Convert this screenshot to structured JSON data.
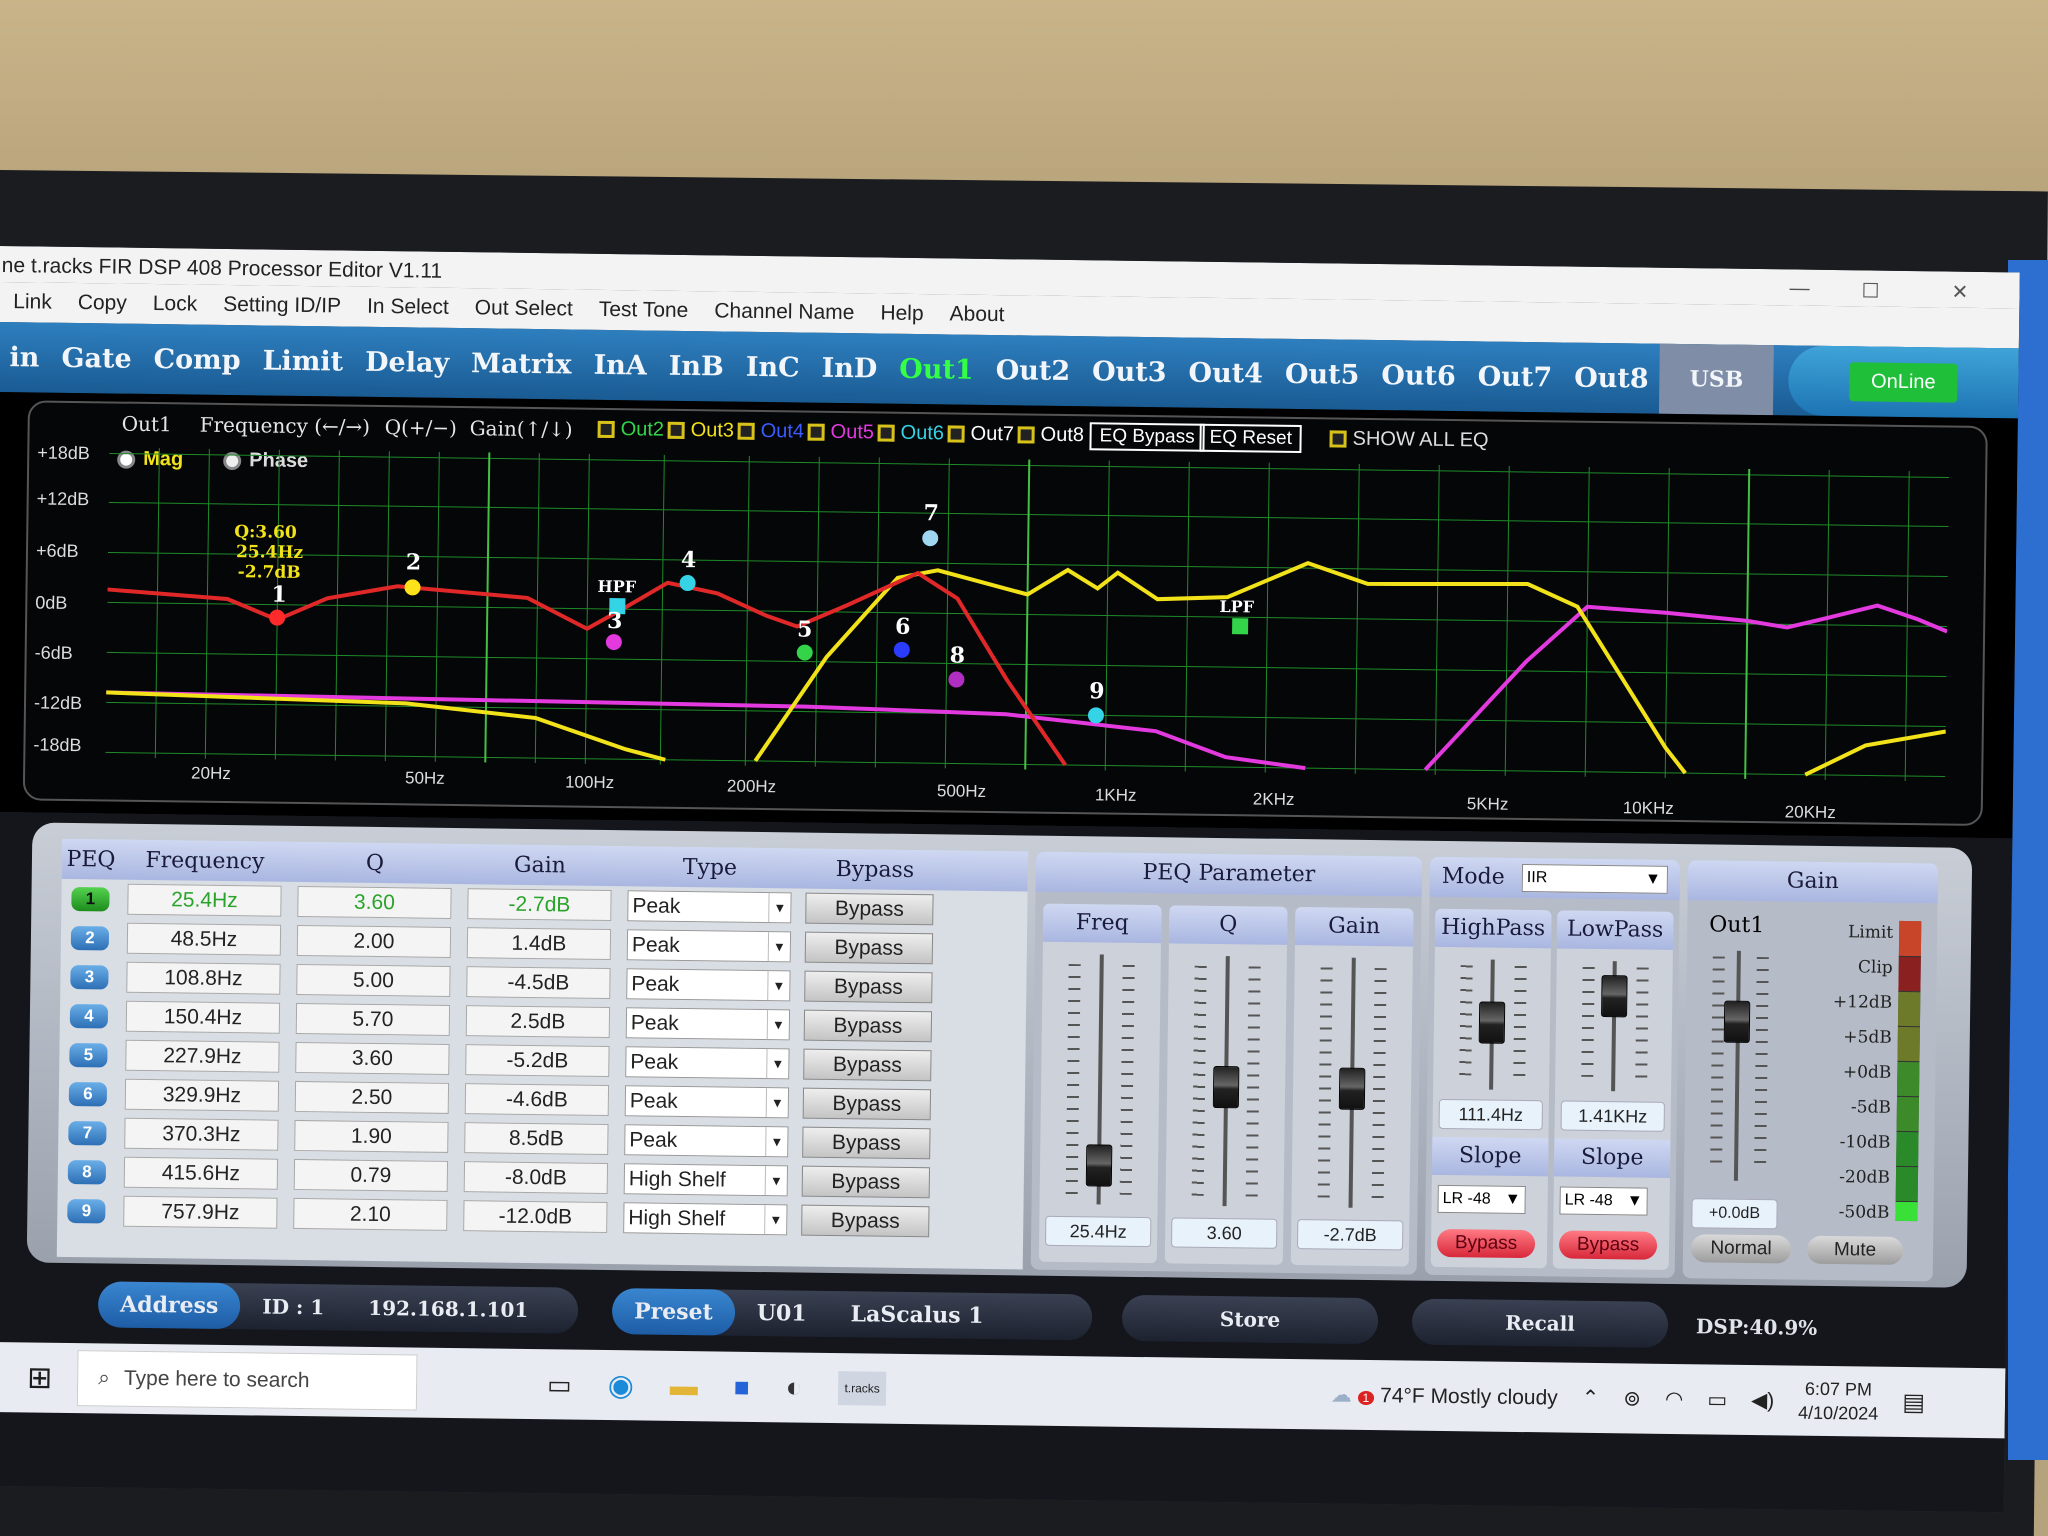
{
  "window": {
    "title": "ne t.racks FIR DSP 408 Processor Editor V1.11",
    "controls": [
      "—",
      "☐",
      "✕"
    ]
  },
  "menu": [
    "Link",
    "Copy",
    "Lock",
    "Setting ID/IP",
    "In Select",
    "Out Select",
    "Test Tone",
    "Channel Name",
    "Help",
    "About"
  ],
  "tabs": [
    "in",
    "Gate",
    "Comp",
    "Limit",
    "Delay",
    "Matrix",
    "InA",
    "InB",
    "InC",
    "InD",
    "Out1",
    "Out2",
    "Out3",
    "Out4",
    "Out5",
    "Out6",
    "Out7",
    "Out8"
  ],
  "active_tab": "Out1",
  "usb_label": "USB",
  "online_label": "OnLine",
  "graph": {
    "channel": "Out1",
    "freq_hint": "Frequency (←/→)",
    "q_hint": "Q(+/−)",
    "gain_hint": "Gain(↑/↓)",
    "overlays": [
      {
        "label": "Out2",
        "color": "#33d44a"
      },
      {
        "label": "Out3",
        "color": "#f2e21a"
      },
      {
        "label": "Out4",
        "color": "#3a5cff"
      },
      {
        "label": "Out5",
        "color": "#e23adf"
      },
      {
        "label": "Out6",
        "color": "#35d3e6"
      },
      {
        "label": "Out7",
        "color": "#ffffff"
      },
      {
        "label": "Out8",
        "color": "#ffffff"
      }
    ],
    "eq_bypass_label": "EQ Bypass",
    "eq_reset_label": "EQ Reset",
    "show_all_label": "SHOW ALL EQ",
    "mag_label": "Mag",
    "phase_label": "Phase",
    "y_ticks": [
      "+18dB",
      "+12dB",
      "+6dB",
      "0dB",
      "-6dB",
      "-12dB",
      "-18dB"
    ],
    "x_ticks": [
      "20Hz",
      "50Hz",
      "100Hz",
      "200Hz",
      "500Hz",
      "1KHz",
      "2KHz",
      "5KHz",
      "10KHz",
      "20KHz"
    ],
    "tooltip": [
      "Q:3.60",
      "25.4Hz",
      "-2.7dB"
    ],
    "hpf_label": "HPF",
    "lpf_label": "LPF",
    "point_labels": [
      "1",
      "2",
      "3",
      "4",
      "5",
      "6",
      "7",
      "8",
      "9"
    ]
  },
  "peq": {
    "headers": [
      "PEQ",
      "Frequency",
      "Q",
      "Gain",
      "Type",
      "Bypass"
    ],
    "rows": [
      {
        "n": "1",
        "freq": "25.4Hz",
        "q": "3.60",
        "gain": "-2.7dB",
        "type": "Peak",
        "bypass": "Bypass"
      },
      {
        "n": "2",
        "freq": "48.5Hz",
        "q": "2.00",
        "gain": "1.4dB",
        "type": "Peak",
        "bypass": "Bypass"
      },
      {
        "n": "3",
        "freq": "108.8Hz",
        "q": "5.00",
        "gain": "-4.5dB",
        "type": "Peak",
        "bypass": "Bypass"
      },
      {
        "n": "4",
        "freq": "150.4Hz",
        "q": "5.70",
        "gain": "2.5dB",
        "type": "Peak",
        "bypass": "Bypass"
      },
      {
        "n": "5",
        "freq": "227.9Hz",
        "q": "3.60",
        "gain": "-5.2dB",
        "type": "Peak",
        "bypass": "Bypass"
      },
      {
        "n": "6",
        "freq": "329.9Hz",
        "q": "2.50",
        "gain": "-4.6dB",
        "type": "Peak",
        "bypass": "Bypass"
      },
      {
        "n": "7",
        "freq": "370.3Hz",
        "q": "1.90",
        "gain": "8.5dB",
        "type": "Peak",
        "bypass": "Bypass"
      },
      {
        "n": "8",
        "freq": "415.6Hz",
        "q": "0.79",
        "gain": "-8.0dB",
        "type": "High Shelf",
        "bypass": "Bypass"
      },
      {
        "n": "9",
        "freq": "757.9Hz",
        "q": "2.10",
        "gain": "-12.0dB",
        "type": "High Shelf",
        "bypass": "Bypass"
      }
    ]
  },
  "peq_param": {
    "title": "PEQ Parameter",
    "freq_label": "Freq",
    "q_label": "Q",
    "gain_label": "Gain",
    "freq_value": "25.4Hz",
    "q_value": "3.60",
    "gain_value": "-2.7dB"
  },
  "filter": {
    "mode_label": "Mode",
    "mode_value": "IIR",
    "highpass_label": "HighPass",
    "lowpass_label": "LowPass",
    "hp_value": "111.4Hz",
    "lp_value": "1.41KHz",
    "slope_label": "Slope",
    "hp_slope": "LR -48",
    "lp_slope": "LR -48",
    "bypass_label": "Bypass"
  },
  "gain_panel": {
    "title": "Gain",
    "channel": "Out1",
    "value": "+0.0dB",
    "normal_label": "Normal",
    "mute_label": "Mute",
    "meter_labels": [
      "Limit",
      "Clip",
      "+12dB",
      "+5dB",
      "+0dB",
      "-5dB",
      "-10dB",
      "-20dB",
      "-50dB"
    ]
  },
  "bottom": {
    "address_label": "Address",
    "id_value": "ID : 1",
    "ip_value": "192.168.1.101",
    "preset_label": "Preset",
    "preset_slot": "U01",
    "preset_name": "LaScalus 1",
    "store_label": "Store",
    "recall_label": "Recall",
    "dsp_load": "DSP:40.9%"
  },
  "taskbar": {
    "search_placeholder": "Type here to search",
    "weather": "74°F  Mostly cloudy",
    "weather_badge": "1",
    "time": "6:07 PM",
    "date": "4/10/2024"
  }
}
